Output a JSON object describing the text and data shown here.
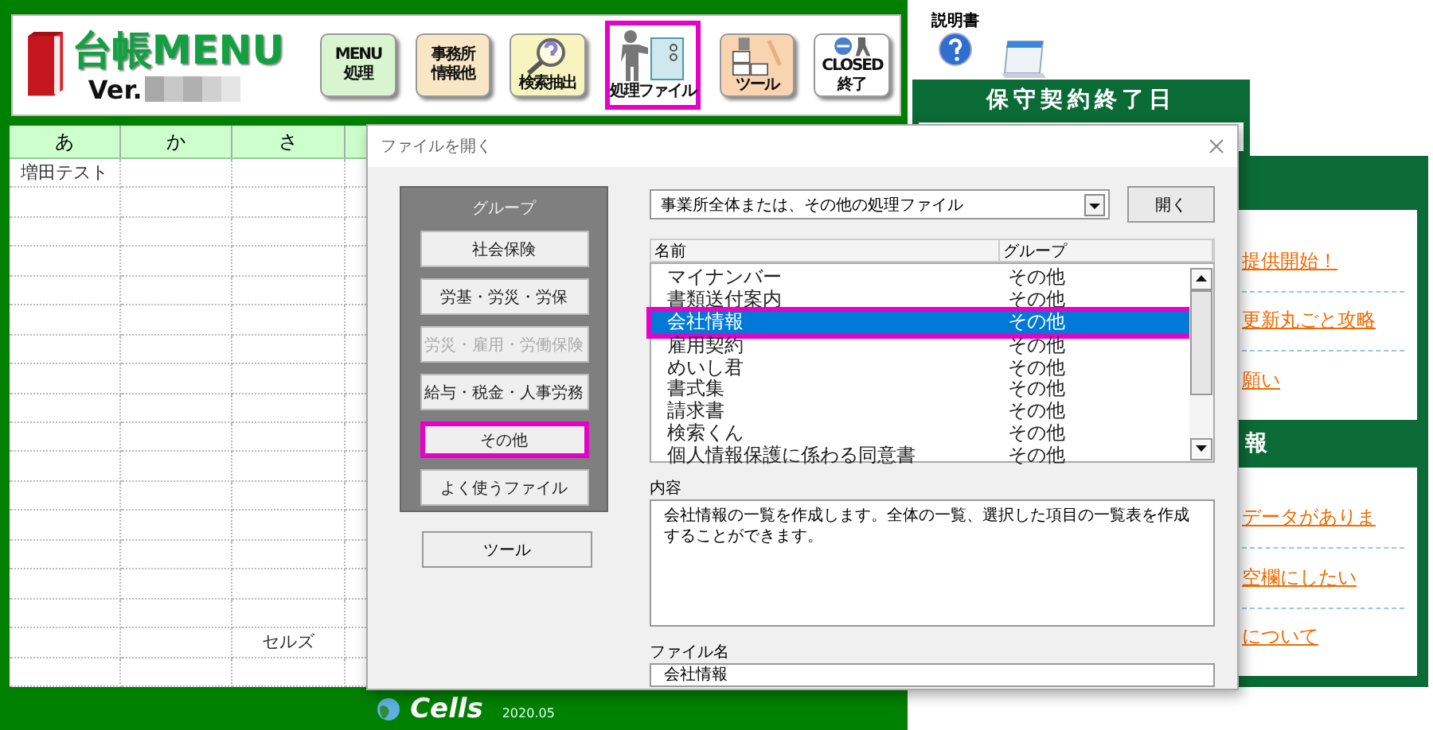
{
  "header": {
    "title": "台帳MENU",
    "version_label": "Ver.",
    "toolbar": [
      {
        "kind": "menu",
        "lines": [
          "MENU",
          "処理"
        ],
        "selected": false
      },
      {
        "kind": "office",
        "lines": [
          "事務所",
          "情報他"
        ],
        "selected": false
      },
      {
        "kind": "search",
        "lines": [
          "検索抽出"
        ],
        "selected": false
      },
      {
        "kind": "files",
        "lines": [
          "処理ファイル"
        ],
        "selected": true
      },
      {
        "kind": "tools",
        "lines": [
          "ツール"
        ],
        "selected": false
      },
      {
        "kind": "close",
        "lines": [
          "CLOSED",
          "終了"
        ],
        "selected": false
      }
    ]
  },
  "table": {
    "columns": [
      "あ",
      "か",
      "さ"
    ],
    "rows": [
      [
        "増田テスト",
        null,
        null
      ],
      [
        null,
        null,
        null
      ],
      [
        null,
        null,
        null
      ],
      [
        null,
        null,
        null
      ],
      [
        null,
        null,
        null
      ],
      [
        null,
        null,
        null
      ],
      [
        null,
        null,
        null
      ],
      [
        null,
        null,
        null
      ],
      [
        null,
        null,
        null
      ],
      [
        null,
        null,
        null
      ],
      [
        null,
        null,
        null
      ],
      [
        null,
        null,
        null
      ],
      [
        null,
        null,
        null
      ],
      [
        null,
        null,
        null
      ],
      [
        null,
        null,
        null
      ],
      [
        null,
        null,
        null
      ],
      [
        null,
        null,
        "セルズ"
      ],
      [
        null,
        null,
        null
      ]
    ]
  },
  "footer": {
    "brand": "Cells",
    "version": "2020.05"
  },
  "manual": {
    "label": "説明書"
  },
  "maintenance": {
    "title": "保守契約終了日"
  },
  "news": [
    "提供開始！",
    "更新丸ごと攻略",
    "願い"
  ],
  "section_2": {
    "title": "報",
    "links": [
      "データがありま",
      "空欄にしたい",
      "について"
    ]
  },
  "dialog": {
    "title": "ファイルを開く",
    "group_title": "グループ",
    "groups": [
      {
        "label": "社会保険",
        "selected": false,
        "disabled": false
      },
      {
        "label": "労基・労災・労保",
        "selected": false,
        "disabled": false
      },
      {
        "label": "労災・雇用・労働保険",
        "selected": false,
        "disabled": true
      },
      {
        "label": "給与・税金・人事労務",
        "selected": false,
        "disabled": false
      },
      {
        "label": "その他",
        "selected": true,
        "disabled": false
      },
      {
        "label": "よく使うファイル",
        "selected": false,
        "disabled": false
      }
    ],
    "tool_button": "ツール",
    "dropdown": "事業所全体または、その他の処理ファイル",
    "open_button": "開く",
    "columns": [
      "名前",
      "グループ"
    ],
    "files": [
      {
        "name": "マイナンバー",
        "group": "その他",
        "selected": false
      },
      {
        "name": "書類送付案内",
        "group": "その他",
        "selected": false
      },
      {
        "name": "会社情報",
        "group": "その他",
        "selected": true
      },
      {
        "name": "雇用契約",
        "group": "その他",
        "selected": false
      },
      {
        "name": "めいし君",
        "group": "その他",
        "selected": false
      },
      {
        "name": "書式集",
        "group": "その他",
        "selected": false
      },
      {
        "name": "請求書",
        "group": "その他",
        "selected": false
      },
      {
        "name": "検索くん",
        "group": "その他",
        "selected": false
      },
      {
        "name": "個人情報保護に係わる同意書",
        "group": "その他",
        "selected": false
      }
    ],
    "content_label": "内容",
    "content": "会社情報の一覧を作成します。全体の一覧、選択した項目の一覧表を作成することができます。",
    "filename_label": "ファイル名",
    "filename": "会社情報"
  }
}
